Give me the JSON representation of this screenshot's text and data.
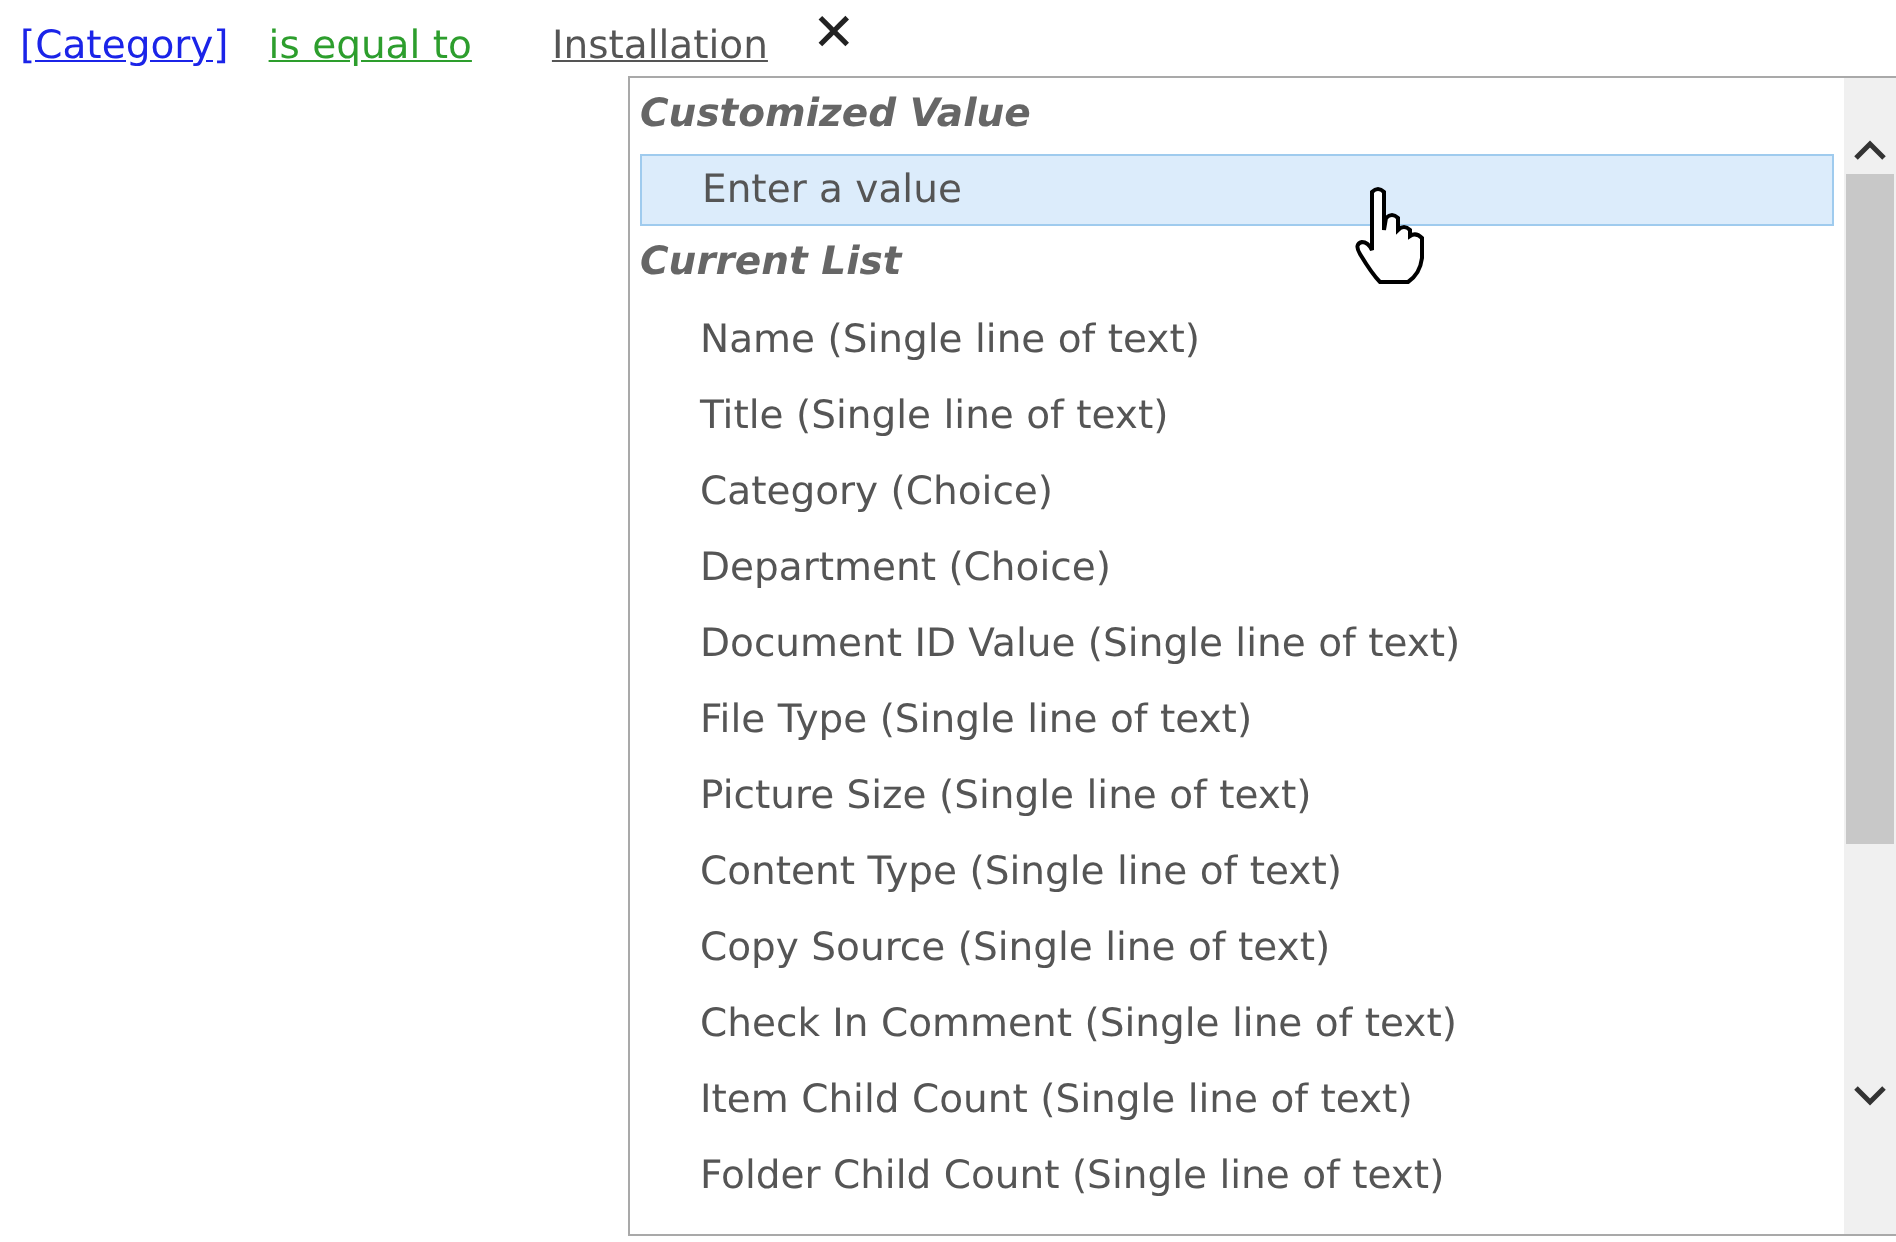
{
  "condition": {
    "field": "[Category]",
    "operator": "is equal to",
    "value": "Installation",
    "remove": "✕"
  },
  "dropdown": {
    "sections": [
      {
        "header": "Customized Value",
        "items": [
          {
            "label": "Enter a value",
            "selected": true
          }
        ]
      },
      {
        "header": "Current List",
        "items": [
          {
            "label": "Name (Single line of text)",
            "selected": false
          },
          {
            "label": "Title (Single line of text)",
            "selected": false
          },
          {
            "label": "Category (Choice)",
            "selected": false
          },
          {
            "label": "Department (Choice)",
            "selected": false
          },
          {
            "label": "Document ID Value (Single line of text)",
            "selected": false
          },
          {
            "label": "File Type (Single line of text)",
            "selected": false
          },
          {
            "label": "Picture Size (Single line of text)",
            "selected": false
          },
          {
            "label": "Content Type (Single line of text)",
            "selected": false
          },
          {
            "label": "Copy Source (Single line of text)",
            "selected": false
          },
          {
            "label": "Check In Comment (Single line of text)",
            "selected": false
          },
          {
            "label": "Item Child Count (Single line of text)",
            "selected": false
          },
          {
            "label": "Folder Child Count (Single line of text)",
            "selected": false
          }
        ]
      }
    ]
  }
}
